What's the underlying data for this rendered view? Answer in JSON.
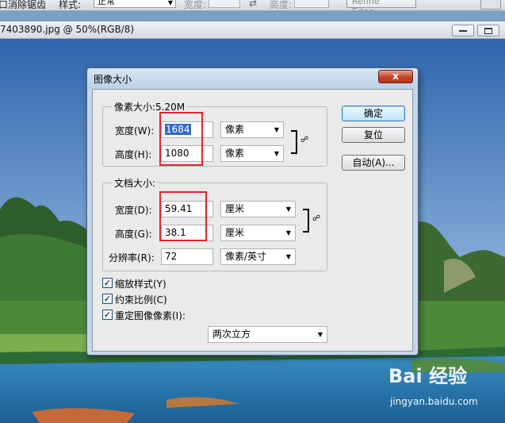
{
  "options_bar": {
    "label_a": "口消除锯齿",
    "style_label": "样式:",
    "style_value": "正常",
    "width_label": "宽度:",
    "height_label": "高度:",
    "refine_edge": "Refine Edge..."
  },
  "document": {
    "title": "7403890.jpg @ 50%(RGB/8)"
  },
  "dialog": {
    "title": "图像大小",
    "close_glyph": "x",
    "pixel_dimensions": {
      "legend": "像素大小:5.20M",
      "width_label": "宽度(W):",
      "width_value": "1684",
      "width_unit": "像素",
      "height_label": "高度(H):",
      "height_value": "1080",
      "height_unit": "像素"
    },
    "document_size": {
      "legend": "文档大小:",
      "width_label": "宽度(D):",
      "width_value": "59.41",
      "width_unit": "厘米",
      "height_label": "高度(G):",
      "height_value": "38.1",
      "height_unit": "厘米",
      "resolution_label": "分辨率(R):",
      "resolution_value": "72",
      "resolution_unit": "像素/英寸"
    },
    "checkboxes": {
      "scale_styles": "缩放样式(Y)",
      "constrain": "约束比例(C)",
      "resample": "重定图像像素(I):"
    },
    "resample_method": "两次立方",
    "buttons": {
      "ok": "确定",
      "reset": "复位",
      "auto": "自动(A)..."
    }
  },
  "watermark": {
    "brand": "Bai 经验",
    "url": "jingyan.baidu.com"
  }
}
